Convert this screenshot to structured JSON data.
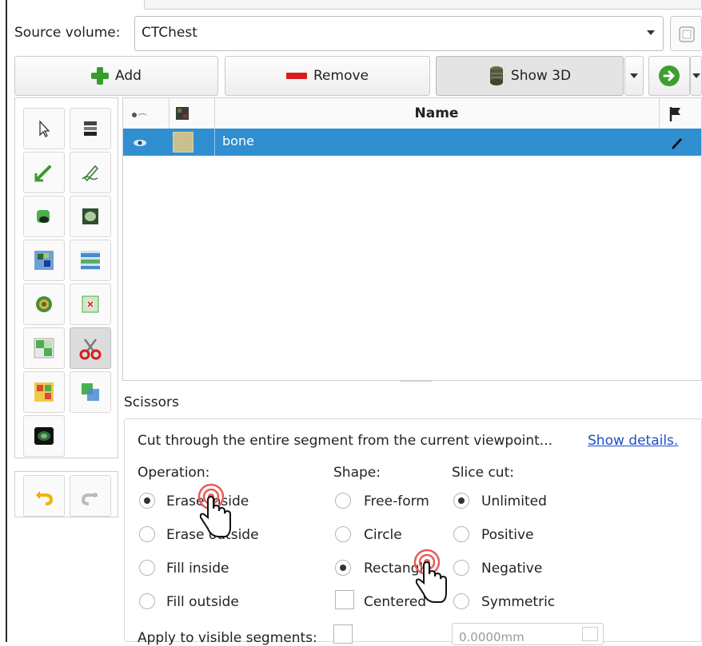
{
  "header": {
    "source_volume_label": "Source volume:",
    "source_volume_value": "CTChest"
  },
  "toolbar": {
    "add_label": "Add",
    "remove_label": "Remove",
    "show3d_label": "Show 3D"
  },
  "segments_table": {
    "columns": [
      "Name"
    ],
    "rows": [
      {
        "name": "bone",
        "color": "#c9c08e",
        "visible": true
      }
    ]
  },
  "effect": {
    "name": "Scissors",
    "description": "Cut through the entire segment from the current viewpoint...",
    "details_link": "Show details.",
    "operation": {
      "label": "Operation:",
      "options": [
        "Erase inside",
        "Erase outside",
        "Fill inside",
        "Fill outside"
      ],
      "selected": "Erase inside"
    },
    "shape": {
      "label": "Shape:",
      "options": [
        "Free-form",
        "Circle",
        "Rectangle"
      ],
      "selected": "Rectangle",
      "centered_label": "Centered",
      "centered_checked": false
    },
    "slice_cut": {
      "label": "Slice cut:",
      "options": [
        "Unlimited",
        "Positive",
        "Negative",
        "Symmetric"
      ],
      "selected": "Unlimited"
    },
    "apply_visible_label": "Apply to visible segments:",
    "apply_visible_checked": false,
    "thickness_value": "0.0000mm"
  },
  "colors": {
    "selection_blue": "#2f8fd0",
    "add_green": "#3a9b2f",
    "remove_red": "#d81e1e",
    "link_blue": "#1d4fc7"
  }
}
